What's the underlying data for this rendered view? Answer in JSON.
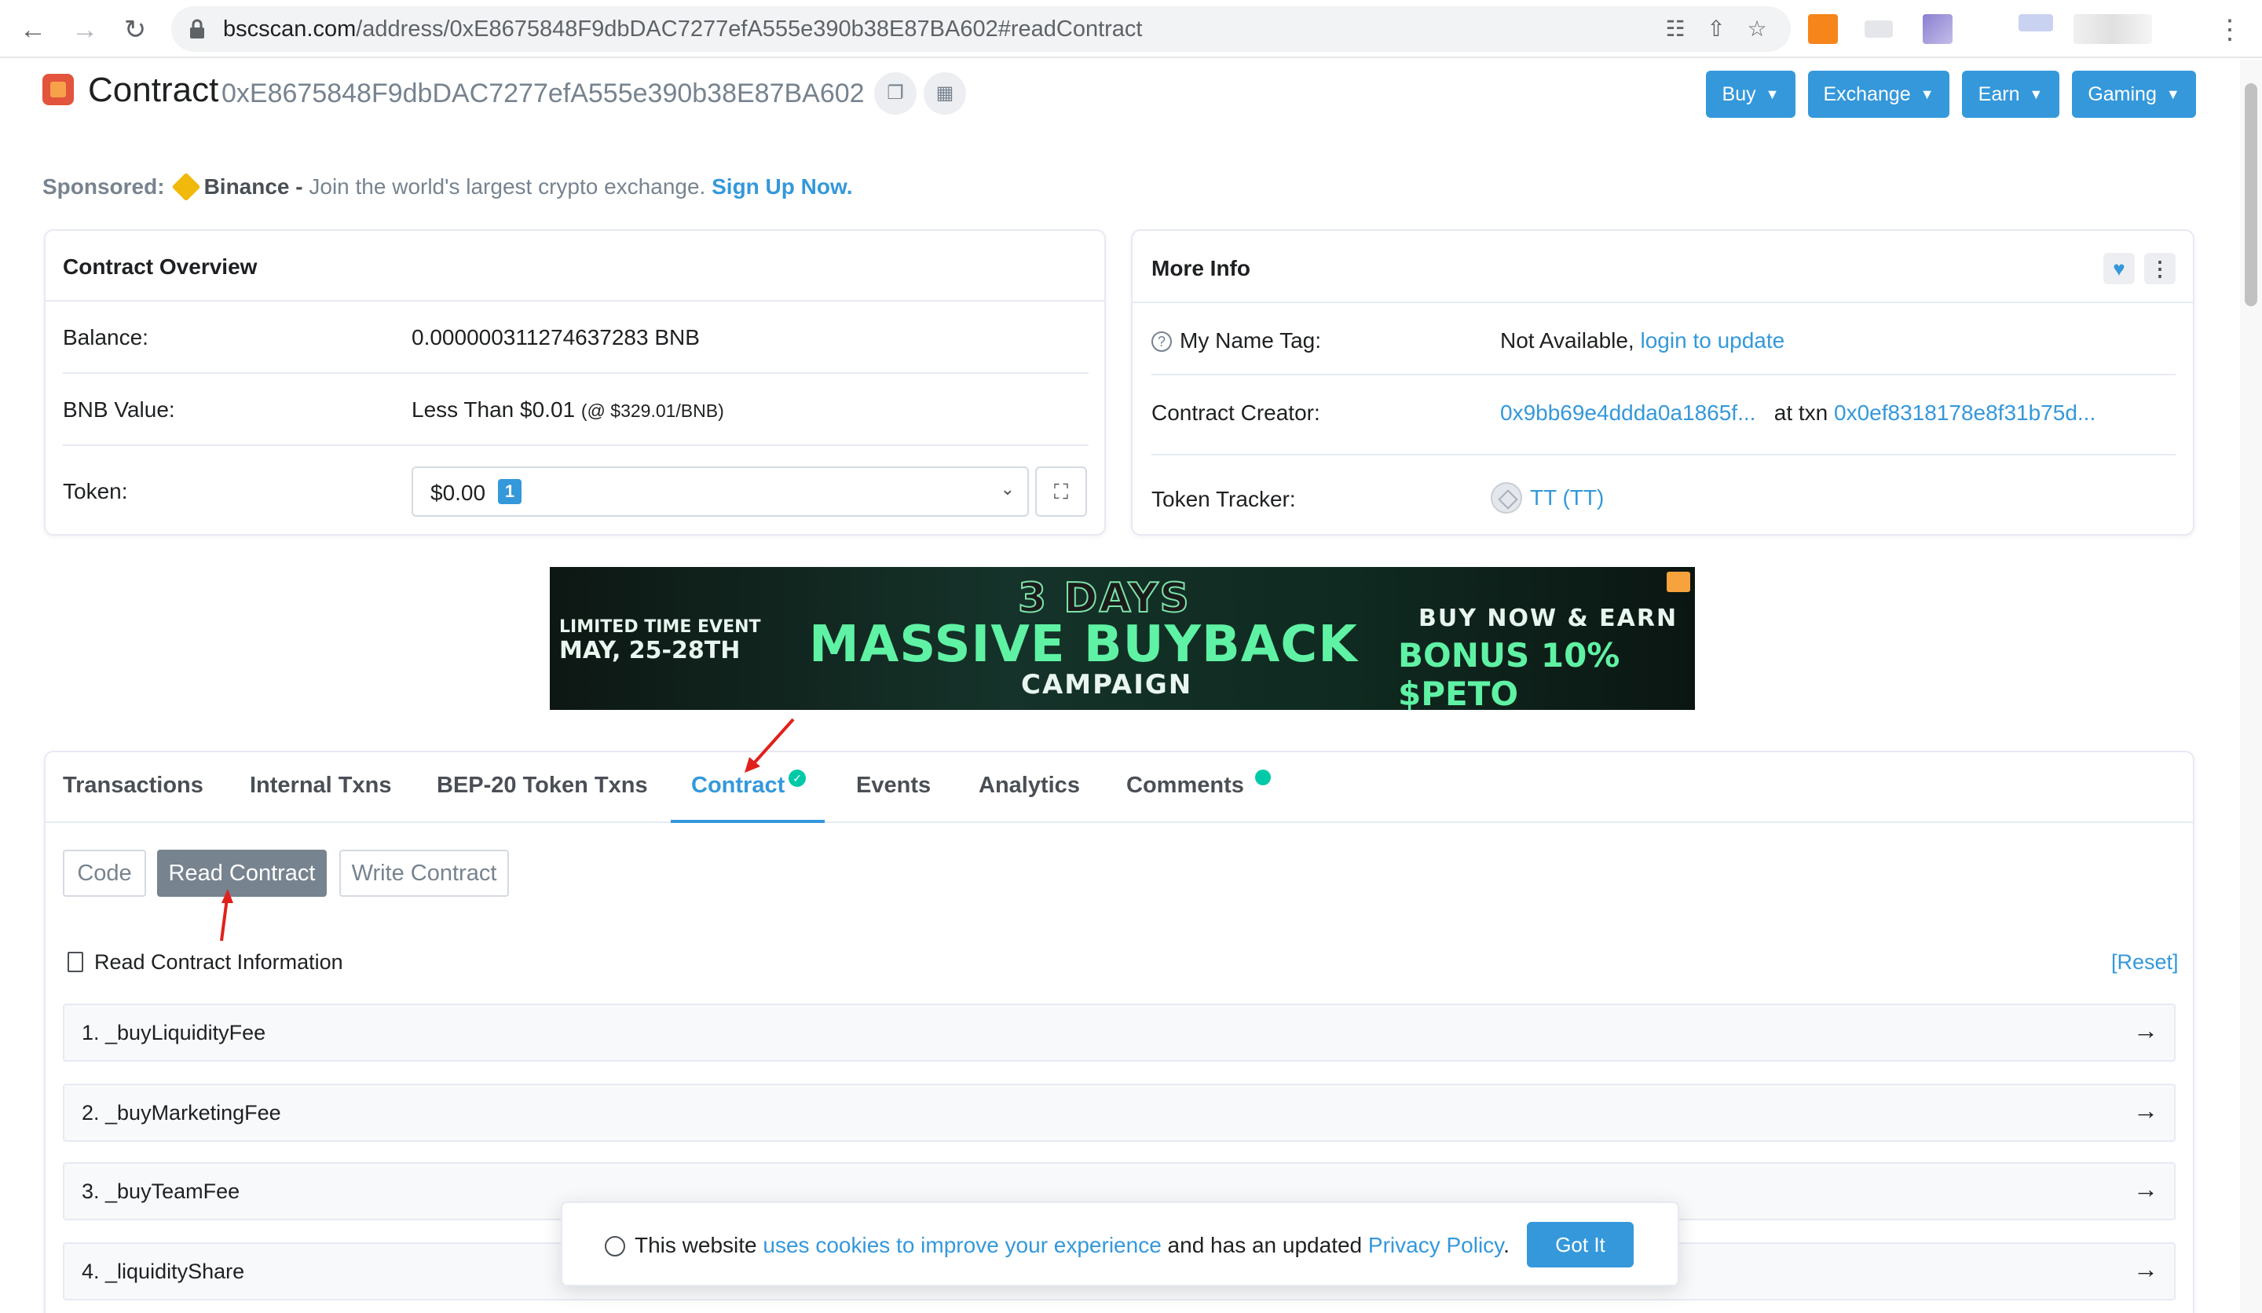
{
  "browser": {
    "url_host": "bscscan.com",
    "url_path": "/address/0xE8675848F9dbDAC7277efA555e390b38E87BA602#readContract"
  },
  "header": {
    "contract_word": "Contract",
    "contract_address": "0xE8675848F9dbDAC7277efA555e390b38E87BA602",
    "buttons": [
      "Buy",
      "Exchange",
      "Earn",
      "Gaming"
    ]
  },
  "sponsored": {
    "label": "Sponsored:",
    "brand": "Binance -",
    "text": " Join the world's largest crypto exchange. ",
    "cta": "Sign Up Now."
  },
  "overview": {
    "title": "Contract Overview",
    "balance_label": "Balance:",
    "balance_value": "0.000000311274637283 BNB",
    "bnb_value_label": "BNB Value:",
    "bnb_value": "Less Than $0.01",
    "bnb_price": "(@ $329.01/BNB)",
    "token_label": "Token:",
    "token_value": "$0.00",
    "token_count": "1"
  },
  "more_info": {
    "title": "More Info",
    "name_tag_label": "My Name Tag:",
    "name_tag_value": "Not Available,",
    "name_tag_link": "login to update",
    "creator_label": "Contract Creator:",
    "creator_address": "0x9bb69e4ddda0a1865f...",
    "creator_at": "at txn",
    "creator_txn": "0x0ef8318178e8f31b75d...",
    "tracker_label": "Token Tracker:",
    "tracker_value": "TT (TT)"
  },
  "banner": {
    "left_line1": "LIMITED TIME EVENT",
    "left_line2": "MAY, 25-28TH",
    "days": "3 DAYS",
    "main": "MASSIVE BUYBACK",
    "campaign": "CAMPAIGN",
    "right_line1": "BUY NOW & EARN",
    "right_line2": "BONUS 10% $PETO"
  },
  "tabs": [
    "Transactions",
    "Internal Txns",
    "BEP-20 Token Txns",
    "Contract",
    "Events",
    "Analytics",
    "Comments"
  ],
  "subtabs": [
    "Code",
    "Read Contract",
    "Write Contract"
  ],
  "read_contract": {
    "title": "Read Contract Information",
    "reset": "[Reset]",
    "items": [
      "1. _buyLiquidityFee",
      "2. _buyMarketingFee",
      "3. _buyTeamFee",
      "4. _liquidityShare"
    ]
  },
  "cookie": {
    "prefix": "This website ",
    "link1": "uses cookies to improve your experience",
    "middle": " and has an updated ",
    "link2": "Privacy Policy",
    "suffix": ".",
    "button": "Got It"
  },
  "colors": {
    "accent": "#3498db",
    "success": "#00c9a7",
    "annotation": "#e0211b"
  }
}
